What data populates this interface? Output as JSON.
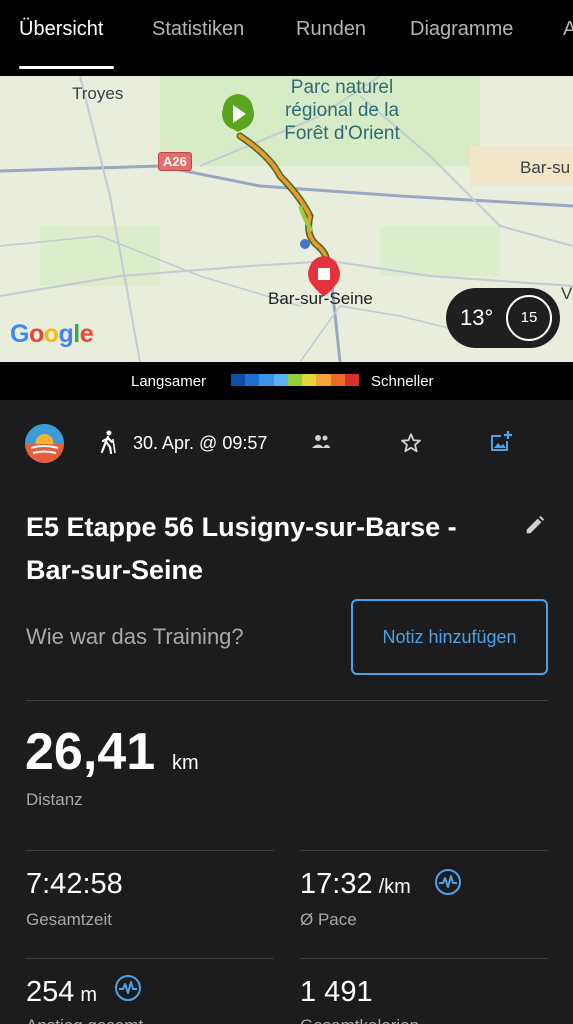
{
  "tabs": [
    {
      "label": "Übersicht",
      "active": true
    },
    {
      "label": "Statistiken",
      "active": false
    },
    {
      "label": "Runden",
      "active": false
    },
    {
      "label": "Diagramme",
      "active": false
    },
    {
      "label": "A",
      "active": false
    }
  ],
  "map": {
    "labels": {
      "troyes": "Troyes",
      "park": "Parc naturel régional de la Forêt d'Orient",
      "road": "A26",
      "bar_right": "Bar-su",
      "bar_seine": "Bar-sur-Seine",
      "v": "V"
    },
    "google": "Google",
    "weather": {
      "temp": "13°",
      "wind": "15"
    }
  },
  "legend": {
    "slow": "Langsamer",
    "fast": "Schneller",
    "colors": [
      "#0e4fa8",
      "#1f6fd0",
      "#3d93e6",
      "#5ab2ef",
      "#8ccf3f",
      "#e3d63b",
      "#f2a43a",
      "#ea6a2a",
      "#d8312a"
    ]
  },
  "activity": {
    "date": "30. Apr. @ 09:57",
    "title": "E5 Etappe 56 Lusigny-sur-Barse - Bar-sur-Seine",
    "question": "Wie war das Training?",
    "note_button": "Notiz hinzufügen"
  },
  "distance": {
    "value": "26,41",
    "unit": "km",
    "label": "Distanz"
  },
  "stats": {
    "total_time": {
      "value": "7:42:58",
      "label": "Gesamtzeit"
    },
    "pace": {
      "value": "17:32",
      "unit": "/km",
      "label": "Ø Pace"
    },
    "ascent": {
      "value": "254",
      "unit": "m",
      "label": "Anstieg gesamt"
    },
    "calories": {
      "value": "1 491",
      "label": "Gesamtkalorien"
    }
  },
  "colors": {
    "accent": "#4aa3e8",
    "background": "#1c1c1e",
    "start": "#5aa51f",
    "end": "#e5323f"
  }
}
